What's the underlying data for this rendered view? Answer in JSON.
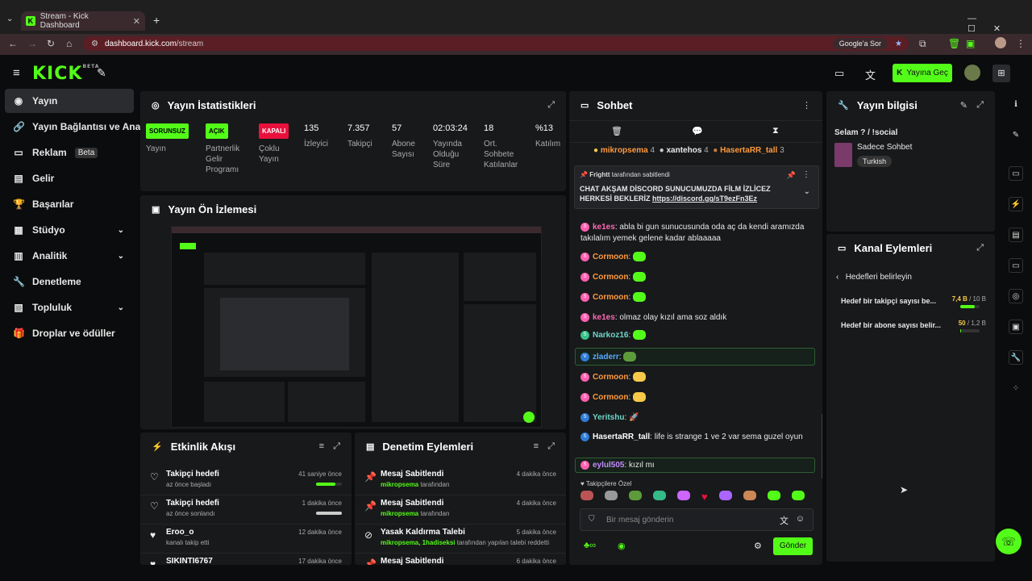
{
  "browser": {
    "tab_title": "Stream - Kick Dashboard",
    "url_domain": "dashboard.kick.com",
    "url_path": "/stream",
    "google_btn": "Google'a Sor"
  },
  "header": {
    "logo": "KICK",
    "logo_beta": "BETA",
    "go_live": "Yayına Geç"
  },
  "sidebar": {
    "items": [
      {
        "label": "Yayın"
      },
      {
        "label": "Yayın Bağlantısı ve Anahtarı"
      },
      {
        "label": "Reklam",
        "badge": "Beta"
      },
      {
        "label": "Gelir"
      },
      {
        "label": "Başarılar"
      },
      {
        "label": "Stüdyo"
      },
      {
        "label": "Analitik"
      },
      {
        "label": "Denetleme"
      },
      {
        "label": "Topluluk"
      },
      {
        "label": "Droplar ve ödüller"
      }
    ]
  },
  "stats": {
    "title": "Yayın İstatistikleri",
    "items": [
      {
        "badge": "SORUNSUZ",
        "label": "Yayın"
      },
      {
        "badge": "AÇIK",
        "label": "Partnerlik Gelir Programı"
      },
      {
        "badge": "KAPALI",
        "label": "Çoklu Yayın"
      },
      {
        "value": "135",
        "label": "İzleyici"
      },
      {
        "value": "7.357",
        "label": "Takipçi"
      },
      {
        "value": "57",
        "label": "Abone Sayısı"
      },
      {
        "value": "02:03:24",
        "label": "Yayında Olduğu Süre"
      },
      {
        "value": "18",
        "label": "Ort. Sohbete Katılanlar"
      },
      {
        "value": "%13",
        "label": "Katılım"
      }
    ]
  },
  "preview": {
    "title": "Yayın Ön İzlemesi"
  },
  "activity": {
    "title": "Etkinlik Akışı",
    "rows": [
      {
        "title": "Takipçi hedefi",
        "sub": "az önce başladı",
        "time": "41 saniye önce",
        "progress": 0.75
      },
      {
        "title": "Takipçi hedefi",
        "sub": "az önce sonlandı",
        "time": "1 dakika önce",
        "progress": 1.0
      },
      {
        "title": "Eroo_o",
        "sub": "kanalı takip etti",
        "time": "12 dakika önce"
      },
      {
        "title": "SIKINTI6767",
        "sub": "",
        "time": "17 dakika önce"
      }
    ]
  },
  "moderation": {
    "title": "Denetim Eylemleri",
    "rows": [
      {
        "title": "Mesaj Sabitlendi",
        "user": "mikropsema",
        "suffix": "tarafından",
        "time": "4 dakika önce"
      },
      {
        "title": "Mesaj Sabitlendi",
        "user": "mikropsema",
        "suffix": "tarafından",
        "time": "4 dakika önce"
      },
      {
        "title": "Yasak Kaldırma Talebi",
        "user": "mikropsema, 1hadiseksi",
        "suffix": "tarafından yapılan talebi reddetti",
        "time": "5 dakika önce"
      },
      {
        "title": "Mesaj Sabitlendi",
        "user": "",
        "suffix": "",
        "time": "6 dakika önce"
      }
    ]
  },
  "chat": {
    "title": "Sohbet",
    "top_gifters": [
      {
        "name": "mikropsema",
        "count": "4"
      },
      {
        "name": "xantehos",
        "count": "4"
      },
      {
        "name": "HasertaRR_tall",
        "count": "3"
      }
    ],
    "pinned": {
      "by": "Frightt",
      "by_suffix": "tarafından sabitlendi",
      "text": "CHAT AKŞAM DİSCORD SUNUCUMUZDA FİLM İZLİCEZ HERKESİ BEKLERİZ",
      "link": "https://discord.gg/sT9ezFn3Ez"
    },
    "messages": [
      {
        "user": "Cormoon",
        "text": ""
      },
      {
        "user": "ke1es",
        "text": "abla bi gun sunucusunda oda aç da kendi aramızda takılalım yemek gelene kadar ablaaaaa"
      },
      {
        "user": "Cormoon",
        "text": ""
      },
      {
        "user": "Cormoon",
        "text": ""
      },
      {
        "user": "Cormoon",
        "text": ""
      },
      {
        "user": "ke1es",
        "text": "olmaz olay kızıl ama soz aldık"
      },
      {
        "user": "Narkoz16",
        "text": ""
      },
      {
        "user": "zladerr",
        "text": ""
      },
      {
        "user": "Cormoon",
        "text": ""
      },
      {
        "user": "Cormoon",
        "text": ""
      },
      {
        "user": "Yeritshu",
        "text": ""
      },
      {
        "user": "HasertaRR_tall",
        "text": "life is strange 1 ve 2 var sema guzel oyun"
      },
      {
        "user": "eylul505",
        "text": "kızıl mı"
      }
    ],
    "followers_only": "Takipçilere Özel",
    "input_placeholder": "Bir mesaj gönderin",
    "send": "Gönder"
  },
  "stream_info": {
    "title": "Yayın bilgisi",
    "stream_title": "Selam ? / !social",
    "category": "Sadece Sohbet",
    "language": "Turkish"
  },
  "channel_actions": {
    "title": "Kanal Eylemleri",
    "back_label": "Hedefleri belirleyin",
    "goals": [
      {
        "label": "Hedef bir takipçi sayısı be...",
        "current": "7,4 B",
        "target": "/ 10 B",
        "progress": 0.74
      },
      {
        "label": "Hedef bir abone sayısı belir...",
        "current": "50",
        "target": "/ 1,2 B",
        "progress": 0.04
      }
    ]
  },
  "colors": {
    "accent": "#53fc18",
    "danger": "#e9113c",
    "panel": "#18191b"
  }
}
